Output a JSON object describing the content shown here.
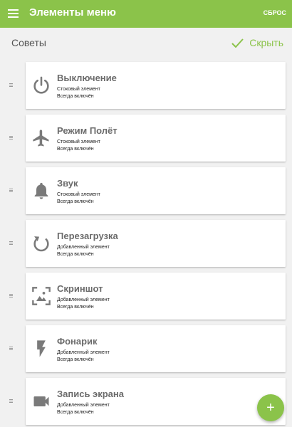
{
  "app_bar": {
    "title": "Элементы меню",
    "reset_label": "СБРОС",
    "menu_icon": "hamburger-menu-icon",
    "color": "#8bc34a"
  },
  "section": {
    "title": "Советы",
    "hide_label": "Скрыть",
    "hide_icon": "check-icon"
  },
  "items": [
    {
      "title": "Выключение",
      "subtitle": "Стоковый элемент",
      "status": "Всегда включён",
      "icon": "power-icon"
    },
    {
      "title": "Режим Полёт",
      "subtitle": "Стоковый элемент",
      "status": "Всегда включён",
      "icon": "airplane-icon"
    },
    {
      "title": "Звук",
      "subtitle": "Стоковый элемент",
      "status": "Всегда включён",
      "icon": "bell-icon"
    },
    {
      "title": "Перезагрузка",
      "subtitle": "Добавленный элемент",
      "status": "Всегда включён",
      "icon": "restart-icon"
    },
    {
      "title": "Скриншот",
      "subtitle": "Добавленный элемент",
      "status": "Всегда включён",
      "icon": "screenshot-icon"
    },
    {
      "title": "Фонарик",
      "subtitle": "Добавленный элемент",
      "status": "Всегда включён",
      "icon": "flash-icon"
    },
    {
      "title": "Запись экрана",
      "subtitle": "Добавленный элемент",
      "status": "Всегда включён",
      "icon": "video-camera-icon"
    }
  ],
  "fab": {
    "label": "+",
    "icon": "add-icon"
  }
}
